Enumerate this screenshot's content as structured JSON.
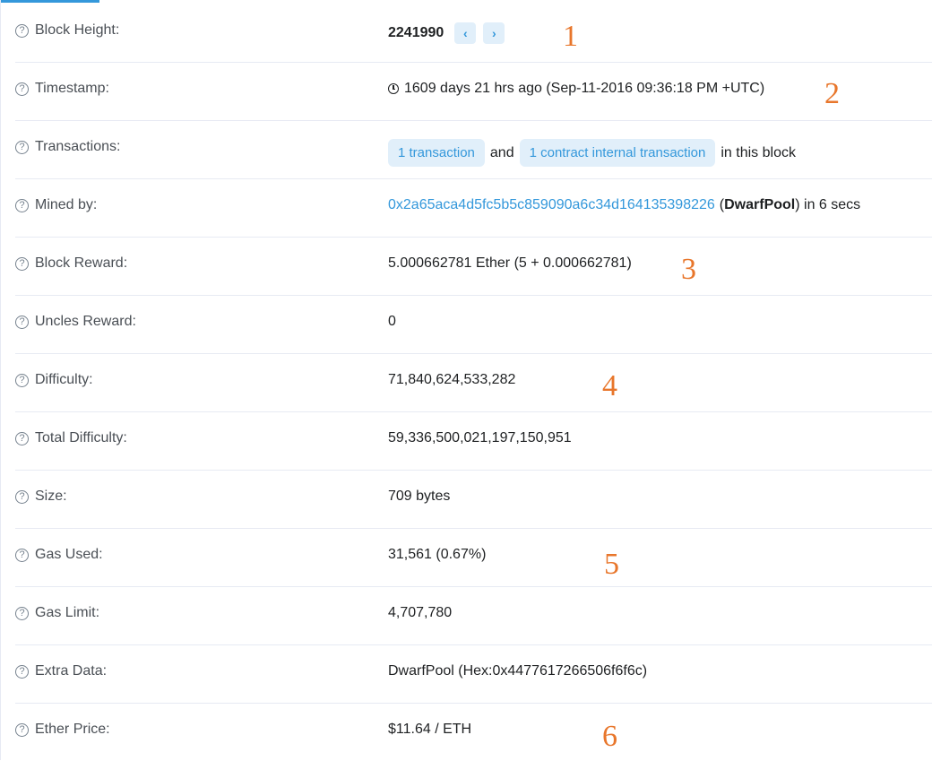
{
  "rows": [
    {
      "label": "Block Height:",
      "value": "2241990",
      "prev_icon": "chevron-left-icon",
      "next_icon": "chevron-right-icon"
    },
    {
      "label": "Timestamp:",
      "icon": "clock-icon",
      "value": "1609 days 21 hrs ago (Sep-11-2016 09:36:18 PM +UTC)"
    },
    {
      "label": "Transactions:",
      "tx_link": "1 transaction",
      "and": "and",
      "internal_link": "1 contract internal transaction",
      "suffix": "in this block"
    },
    {
      "label": "Mined by:",
      "address": "0x2a65aca4d5fc5b5c859090a6c34d164135398226",
      "paren_open": "(",
      "pool": "DwarfPool",
      "suffix": ") in 6 secs"
    },
    {
      "label": "Block Reward:",
      "value": "5.000662781 Ether (5 + 0.000662781)"
    },
    {
      "label": "Uncles Reward:",
      "value": "0"
    },
    {
      "label": "Difficulty:",
      "value": "71,840,624,533,282"
    },
    {
      "label": "Total Difficulty:",
      "value": "59,336,500,021,197,150,951"
    },
    {
      "label": "Size:",
      "value": "709 bytes"
    },
    {
      "label": "Gas Used:",
      "value": "31,561 (0.67%)"
    },
    {
      "label": "Gas Limit:",
      "value": "4,707,780"
    },
    {
      "label": "Extra Data:",
      "value": "DwarfPool (Hex:0x4477617266506f6f6c)"
    },
    {
      "label": "Ether Price:",
      "value": "$11.64 / ETH"
    }
  ],
  "help_icon": "question-circle-icon",
  "help_glyph": "?",
  "prev_glyph": "‹",
  "next_glyph": "›",
  "annotations": [
    "1",
    "2",
    "3",
    "4",
    "5",
    "6"
  ],
  "colors": {
    "accent": "#3498db",
    "pill_bg": "#e1effa",
    "annotation": "#e8762b",
    "divider": "#e7eaf3"
  }
}
